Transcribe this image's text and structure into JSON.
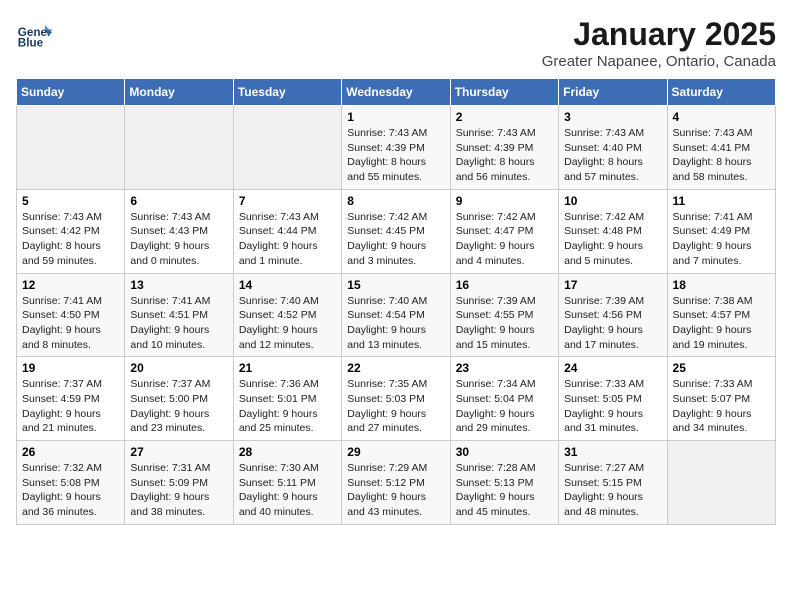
{
  "header": {
    "logo_line1": "General",
    "logo_line2": "Blue",
    "title": "January 2025",
    "subtitle": "Greater Napanee, Ontario, Canada"
  },
  "days_of_week": [
    "Sunday",
    "Monday",
    "Tuesday",
    "Wednesday",
    "Thursday",
    "Friday",
    "Saturday"
  ],
  "weeks": [
    [
      {
        "day": "",
        "info": ""
      },
      {
        "day": "",
        "info": ""
      },
      {
        "day": "",
        "info": ""
      },
      {
        "day": "1",
        "info": "Sunrise: 7:43 AM\nSunset: 4:39 PM\nDaylight: 8 hours\nand 55 minutes."
      },
      {
        "day": "2",
        "info": "Sunrise: 7:43 AM\nSunset: 4:39 PM\nDaylight: 8 hours\nand 56 minutes."
      },
      {
        "day": "3",
        "info": "Sunrise: 7:43 AM\nSunset: 4:40 PM\nDaylight: 8 hours\nand 57 minutes."
      },
      {
        "day": "4",
        "info": "Sunrise: 7:43 AM\nSunset: 4:41 PM\nDaylight: 8 hours\nand 58 minutes."
      }
    ],
    [
      {
        "day": "5",
        "info": "Sunrise: 7:43 AM\nSunset: 4:42 PM\nDaylight: 8 hours\nand 59 minutes."
      },
      {
        "day": "6",
        "info": "Sunrise: 7:43 AM\nSunset: 4:43 PM\nDaylight: 9 hours\nand 0 minutes."
      },
      {
        "day": "7",
        "info": "Sunrise: 7:43 AM\nSunset: 4:44 PM\nDaylight: 9 hours\nand 1 minute."
      },
      {
        "day": "8",
        "info": "Sunrise: 7:42 AM\nSunset: 4:45 PM\nDaylight: 9 hours\nand 3 minutes."
      },
      {
        "day": "9",
        "info": "Sunrise: 7:42 AM\nSunset: 4:47 PM\nDaylight: 9 hours\nand 4 minutes."
      },
      {
        "day": "10",
        "info": "Sunrise: 7:42 AM\nSunset: 4:48 PM\nDaylight: 9 hours\nand 5 minutes."
      },
      {
        "day": "11",
        "info": "Sunrise: 7:41 AM\nSunset: 4:49 PM\nDaylight: 9 hours\nand 7 minutes."
      }
    ],
    [
      {
        "day": "12",
        "info": "Sunrise: 7:41 AM\nSunset: 4:50 PM\nDaylight: 9 hours\nand 8 minutes."
      },
      {
        "day": "13",
        "info": "Sunrise: 7:41 AM\nSunset: 4:51 PM\nDaylight: 9 hours\nand 10 minutes."
      },
      {
        "day": "14",
        "info": "Sunrise: 7:40 AM\nSunset: 4:52 PM\nDaylight: 9 hours\nand 12 minutes."
      },
      {
        "day": "15",
        "info": "Sunrise: 7:40 AM\nSunset: 4:54 PM\nDaylight: 9 hours\nand 13 minutes."
      },
      {
        "day": "16",
        "info": "Sunrise: 7:39 AM\nSunset: 4:55 PM\nDaylight: 9 hours\nand 15 minutes."
      },
      {
        "day": "17",
        "info": "Sunrise: 7:39 AM\nSunset: 4:56 PM\nDaylight: 9 hours\nand 17 minutes."
      },
      {
        "day": "18",
        "info": "Sunrise: 7:38 AM\nSunset: 4:57 PM\nDaylight: 9 hours\nand 19 minutes."
      }
    ],
    [
      {
        "day": "19",
        "info": "Sunrise: 7:37 AM\nSunset: 4:59 PM\nDaylight: 9 hours\nand 21 minutes."
      },
      {
        "day": "20",
        "info": "Sunrise: 7:37 AM\nSunset: 5:00 PM\nDaylight: 9 hours\nand 23 minutes."
      },
      {
        "day": "21",
        "info": "Sunrise: 7:36 AM\nSunset: 5:01 PM\nDaylight: 9 hours\nand 25 minutes."
      },
      {
        "day": "22",
        "info": "Sunrise: 7:35 AM\nSunset: 5:03 PM\nDaylight: 9 hours\nand 27 minutes."
      },
      {
        "day": "23",
        "info": "Sunrise: 7:34 AM\nSunset: 5:04 PM\nDaylight: 9 hours\nand 29 minutes."
      },
      {
        "day": "24",
        "info": "Sunrise: 7:33 AM\nSunset: 5:05 PM\nDaylight: 9 hours\nand 31 minutes."
      },
      {
        "day": "25",
        "info": "Sunrise: 7:33 AM\nSunset: 5:07 PM\nDaylight: 9 hours\nand 34 minutes."
      }
    ],
    [
      {
        "day": "26",
        "info": "Sunrise: 7:32 AM\nSunset: 5:08 PM\nDaylight: 9 hours\nand 36 minutes."
      },
      {
        "day": "27",
        "info": "Sunrise: 7:31 AM\nSunset: 5:09 PM\nDaylight: 9 hours\nand 38 minutes."
      },
      {
        "day": "28",
        "info": "Sunrise: 7:30 AM\nSunset: 5:11 PM\nDaylight: 9 hours\nand 40 minutes."
      },
      {
        "day": "29",
        "info": "Sunrise: 7:29 AM\nSunset: 5:12 PM\nDaylight: 9 hours\nand 43 minutes."
      },
      {
        "day": "30",
        "info": "Sunrise: 7:28 AM\nSunset: 5:13 PM\nDaylight: 9 hours\nand 45 minutes."
      },
      {
        "day": "31",
        "info": "Sunrise: 7:27 AM\nSunset: 5:15 PM\nDaylight: 9 hours\nand 48 minutes."
      },
      {
        "day": "",
        "info": ""
      }
    ]
  ]
}
